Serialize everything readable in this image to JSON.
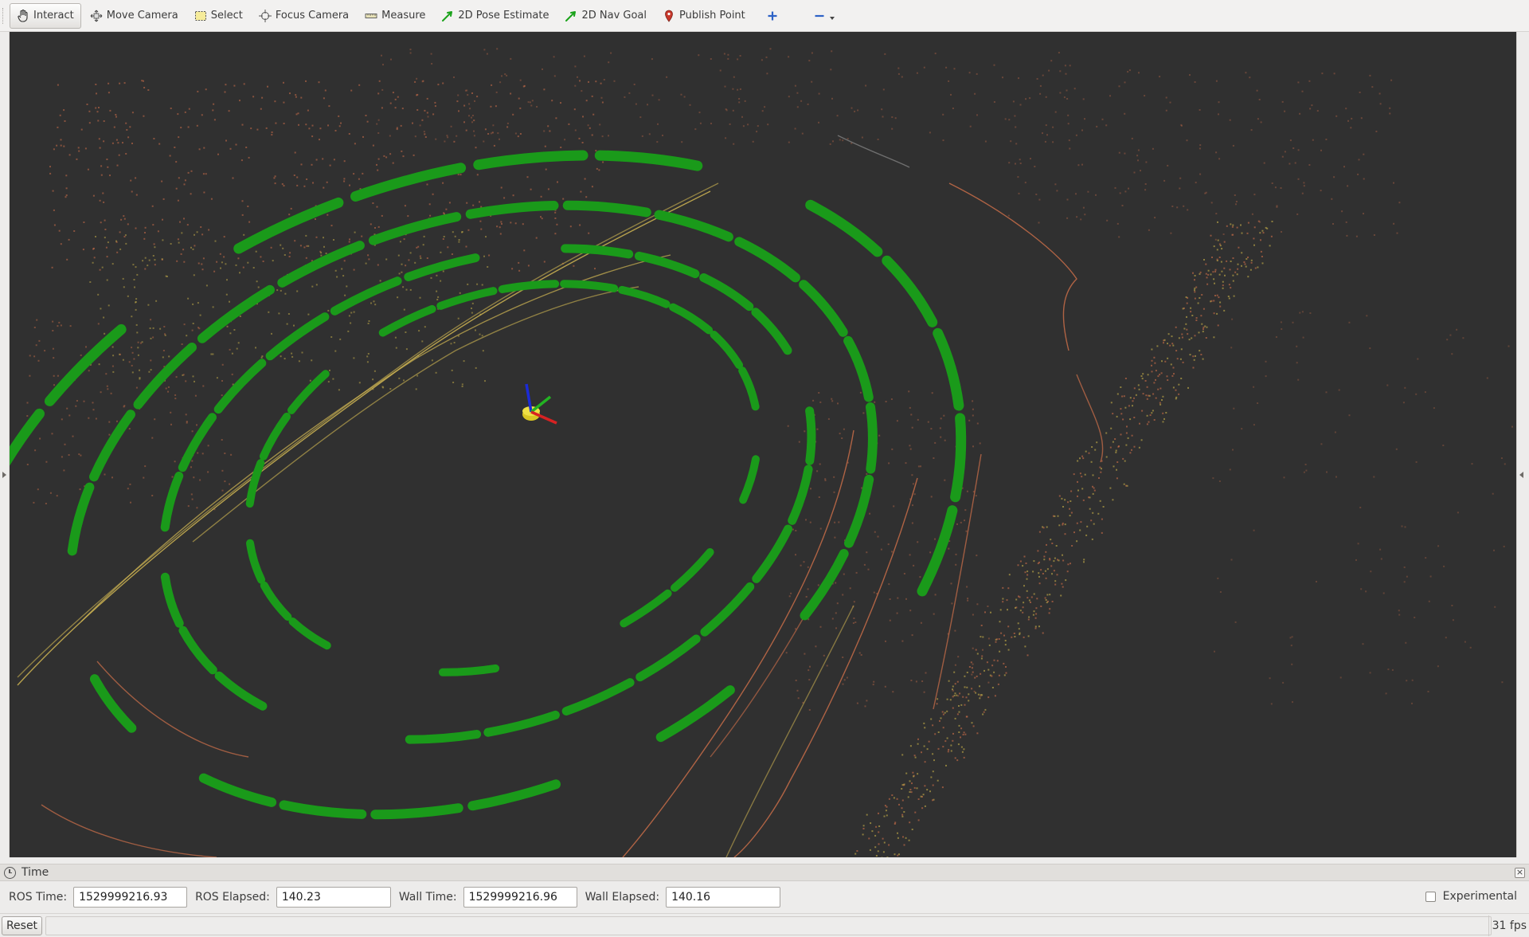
{
  "toolbar": {
    "tools": [
      {
        "label": "Interact",
        "icon": "hand-icon",
        "active": true
      },
      {
        "label": "Move Camera",
        "icon": "move-camera-icon"
      },
      {
        "label": "Select",
        "icon": "select-box-icon"
      },
      {
        "label": "Focus Camera",
        "icon": "focus-camera-icon"
      },
      {
        "label": "Measure",
        "icon": "ruler-icon"
      },
      {
        "label": "2D Pose Estimate",
        "icon": "green-arrow-icon"
      },
      {
        "label": "2D Nav Goal",
        "icon": "green-arrow-icon"
      },
      {
        "label": "Publish Point",
        "icon": "map-pin-icon"
      }
    ],
    "add_tool_icon": "plus-icon",
    "remove_tool_icon": "minus-icon"
  },
  "viewport": {
    "background": "#303030",
    "ring_color": "#1a9a1a",
    "scan_color_warm": "#d0704a",
    "scan_color_yellow": "#c9b24a"
  },
  "time_panel": {
    "title": "Time",
    "ros_time_label": "ROS Time:",
    "ros_time": "1529999216.93",
    "ros_elapsed_label": "ROS Elapsed:",
    "ros_elapsed": "140.23",
    "wall_time_label": "Wall Time:",
    "wall_time": "1529999216.96",
    "wall_elapsed_label": "Wall Elapsed:",
    "wall_elapsed": "140.16",
    "experimental_label": "Experimental",
    "experimental_checked": false
  },
  "status": {
    "reset_label": "Reset",
    "fps": "31 fps"
  }
}
